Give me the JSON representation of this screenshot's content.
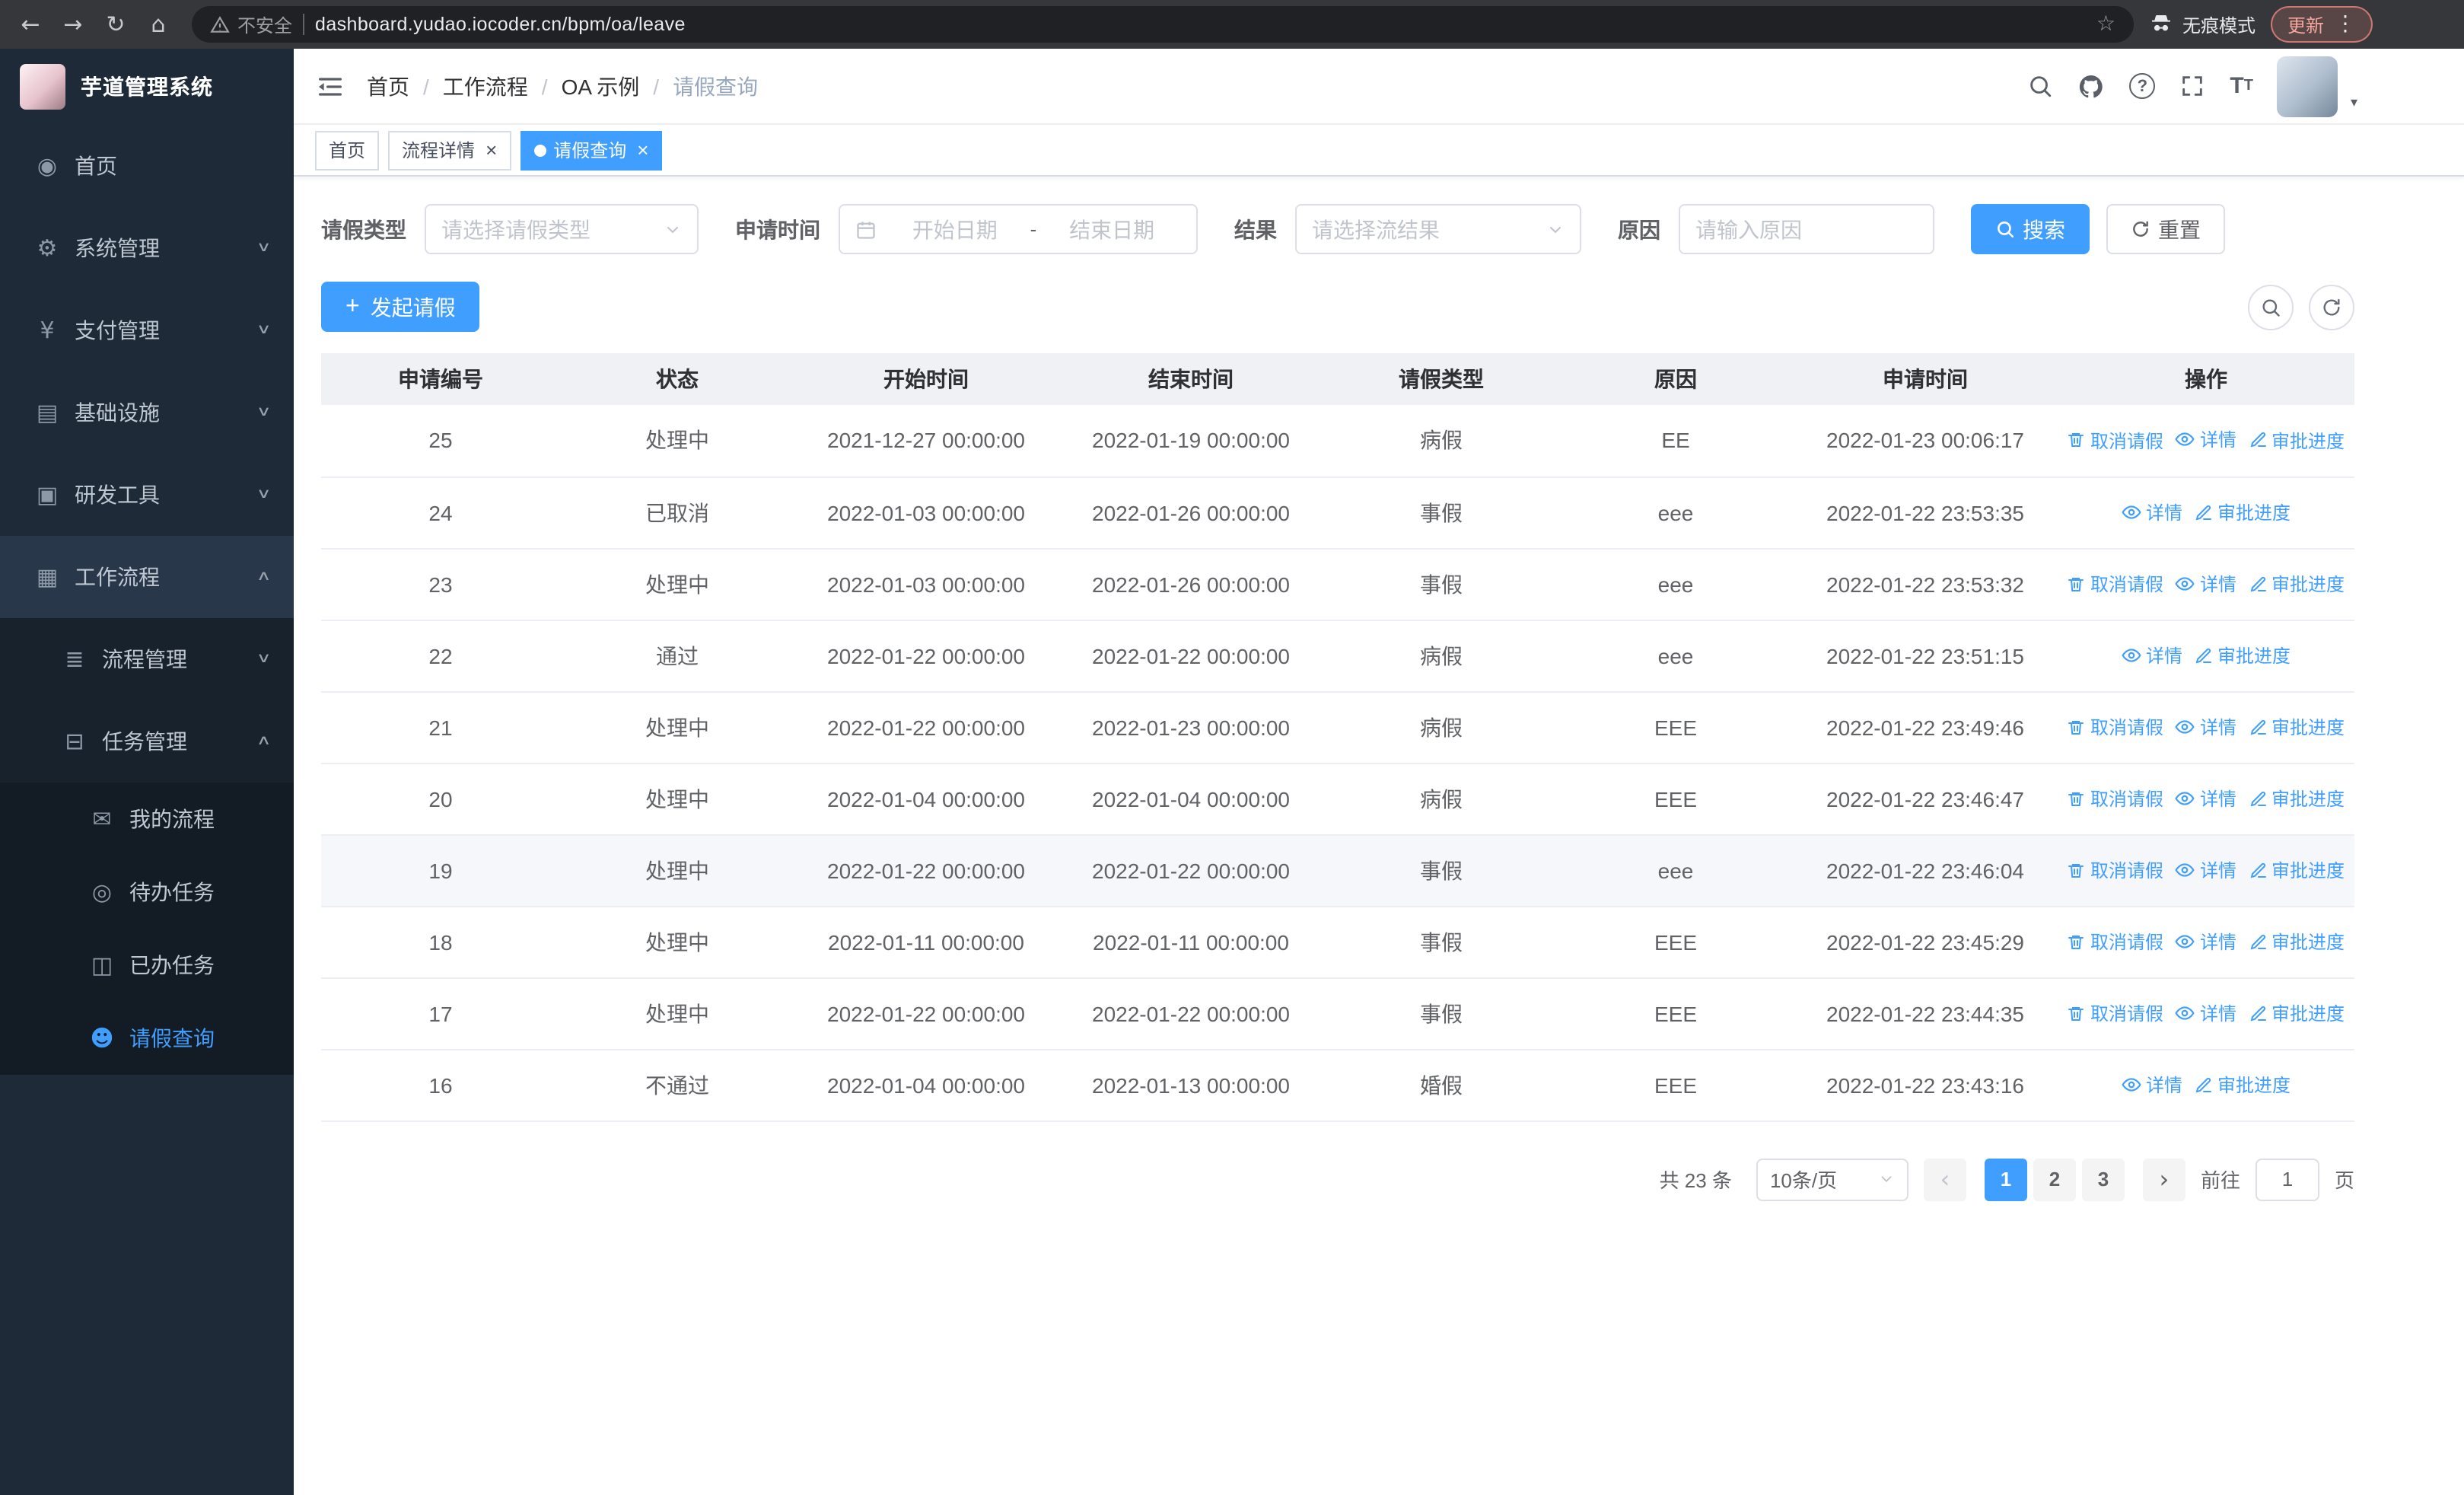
{
  "browser": {
    "security_warning": "不安全",
    "url": "dashboard.yudao.iocoder.cn/bpm/oa/leave",
    "incognito_label": "无痕模式",
    "update_label": "更新"
  },
  "sidebar": {
    "title": "芋道管理系统",
    "menu": [
      {
        "key": "home",
        "icon": "home-icon",
        "label": "首页",
        "level": 1
      },
      {
        "key": "system-management",
        "icon": "gear-icon",
        "label": "系统管理",
        "level": 1,
        "arrow": "down"
      },
      {
        "key": "payment-management",
        "icon": "payment-icon",
        "label": "支付管理",
        "level": 1,
        "arrow": "down"
      },
      {
        "key": "infrastructure",
        "icon": "infrastructure-icon",
        "label": "基础设施",
        "level": 1,
        "arrow": "down"
      },
      {
        "key": "dev-tools",
        "icon": "tools-icon",
        "label": "研发工具",
        "level": 1,
        "arrow": "down"
      },
      {
        "key": "workflow",
        "icon": "workflow-icon",
        "label": "工作流程",
        "level": 1,
        "arrow": "up",
        "highlight": true
      },
      {
        "key": "process-management",
        "icon": "process-icon",
        "label": "流程管理",
        "level": 2,
        "arrow": "down"
      },
      {
        "key": "task-management",
        "icon": "task-icon",
        "label": "任务管理",
        "level": 2,
        "arrow": "up"
      },
      {
        "key": "my-process",
        "icon": "my-process-icon",
        "label": "我的流程",
        "level": 3
      },
      {
        "key": "todo-tasks",
        "icon": "todo-icon",
        "label": "待办任务",
        "level": 3
      },
      {
        "key": "done-tasks",
        "icon": "done-icon",
        "label": "已办任务",
        "level": 3
      },
      {
        "key": "leave-query",
        "icon": "leave-icon",
        "label": "请假查询",
        "level": 3,
        "active": true
      }
    ]
  },
  "header": {
    "breadcrumb": [
      {
        "key": "home",
        "label": "首页"
      },
      {
        "key": "workflow",
        "label": "工作流程"
      },
      {
        "key": "oa-example",
        "label": "OA 示例"
      },
      {
        "key": "leave-query",
        "label": "请假查询"
      }
    ]
  },
  "tabs": [
    {
      "key": "home",
      "label": "首页",
      "closable": false,
      "active": false
    },
    {
      "key": "process-detail",
      "label": "流程详情",
      "closable": true,
      "active": false
    },
    {
      "key": "leave-query",
      "label": "请假查询",
      "closable": true,
      "active": true
    }
  ],
  "filters": {
    "leave_type_label": "请假类型",
    "leave_type_placeholder": "请选择请假类型",
    "apply_time_label": "申请时间",
    "start_date_placeholder": "开始日期",
    "date_separator": "-",
    "end_date_placeholder": "结束日期",
    "result_label": "结果",
    "result_placeholder": "请选择流结果",
    "reason_label": "原因",
    "reason_placeholder": "请输入原因",
    "search_button": "搜索",
    "reset_button": "重置"
  },
  "toolbar": {
    "create_button": "发起请假"
  },
  "table": {
    "columns": [
      "申请编号",
      "状态",
      "开始时间",
      "结束时间",
      "请假类型",
      "原因",
      "申请时间",
      "操作"
    ],
    "actions": {
      "cancel": "取消请假",
      "detail": "详情",
      "progress": "审批进度"
    },
    "rows": [
      {
        "id": "25",
        "status": "处理中",
        "start": "2021-12-27 00:00:00",
        "end": "2022-01-19 00:00:00",
        "type": "病假",
        "reason": "EE",
        "applied": "2022-01-23 00:06:17",
        "cancelable": true
      },
      {
        "id": "24",
        "status": "已取消",
        "start": "2022-01-03 00:00:00",
        "end": "2022-01-26 00:00:00",
        "type": "事假",
        "reason": "eee",
        "applied": "2022-01-22 23:53:35",
        "cancelable": false
      },
      {
        "id": "23",
        "status": "处理中",
        "start": "2022-01-03 00:00:00",
        "end": "2022-01-26 00:00:00",
        "type": "事假",
        "reason": "eee",
        "applied": "2022-01-22 23:53:32",
        "cancelable": true
      },
      {
        "id": "22",
        "status": "通过",
        "start": "2022-01-22 00:00:00",
        "end": "2022-01-22 00:00:00",
        "type": "病假",
        "reason": "eee",
        "applied": "2022-01-22 23:51:15",
        "cancelable": false
      },
      {
        "id": "21",
        "status": "处理中",
        "start": "2022-01-22 00:00:00",
        "end": "2022-01-23 00:00:00",
        "type": "病假",
        "reason": "EEE",
        "applied": "2022-01-22 23:49:46",
        "cancelable": true
      },
      {
        "id": "20",
        "status": "处理中",
        "start": "2022-01-04 00:00:00",
        "end": "2022-01-04 00:00:00",
        "type": "病假",
        "reason": "EEE",
        "applied": "2022-01-22 23:46:47",
        "cancelable": true
      },
      {
        "id": "19",
        "status": "处理中",
        "start": "2022-01-22 00:00:00",
        "end": "2022-01-22 00:00:00",
        "type": "事假",
        "reason": "eee",
        "applied": "2022-01-22 23:46:04",
        "cancelable": true,
        "hover": true
      },
      {
        "id": "18",
        "status": "处理中",
        "start": "2022-01-11 00:00:00",
        "end": "2022-01-11 00:00:00",
        "type": "事假",
        "reason": "EEE",
        "applied": "2022-01-22 23:45:29",
        "cancelable": true
      },
      {
        "id": "17",
        "status": "处理中",
        "start": "2022-01-22 00:00:00",
        "end": "2022-01-22 00:00:00",
        "type": "事假",
        "reason": "EEE",
        "applied": "2022-01-22 23:44:35",
        "cancelable": true
      },
      {
        "id": "16",
        "status": "不通过",
        "start": "2022-01-04 00:00:00",
        "end": "2022-01-13 00:00:00",
        "type": "婚假",
        "reason": "EEE",
        "applied": "2022-01-22 23:43:16",
        "cancelable": false
      }
    ]
  },
  "pagination": {
    "total_text": "共 23 条",
    "page_size": "10条/页",
    "pages": [
      "1",
      "2",
      "3"
    ],
    "active_page": "1",
    "goto_label": "前往",
    "goto_value": "1",
    "goto_suffix": "页"
  },
  "colors": {
    "primary": "#409eff",
    "sidebar_bg": "#1e2a38",
    "table_header_bg": "#eff1f5",
    "active_tab_bg": "#409eff"
  }
}
